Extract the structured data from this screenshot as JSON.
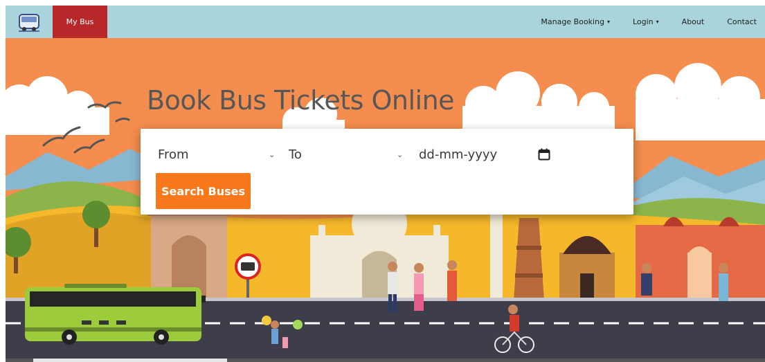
{
  "nav": {
    "brand": "My Bus",
    "items": [
      {
        "label": "Manage Booking",
        "dropdown": true
      },
      {
        "label": "Login",
        "dropdown": true
      },
      {
        "label": "About",
        "dropdown": false
      },
      {
        "label": "Contact",
        "dropdown": false
      }
    ],
    "caret": "▾"
  },
  "hero": {
    "title": "Book Bus Tickets Online",
    "bus_sign": "🚌"
  },
  "search": {
    "from": "From",
    "to": "To",
    "date": "dd-mm-yyyy",
    "chevron": "⌄",
    "button": "Search Buses"
  },
  "colors": {
    "navbar": "#a9d4dc",
    "brand": "#b8282a",
    "sky": "#f48d4e",
    "accent_button": "#f7791b",
    "road": "#3e3d4a",
    "bus": "#9ccc3c"
  },
  "icons": {
    "logo": "bus-logo-icon",
    "calendar": "calendar-icon"
  }
}
